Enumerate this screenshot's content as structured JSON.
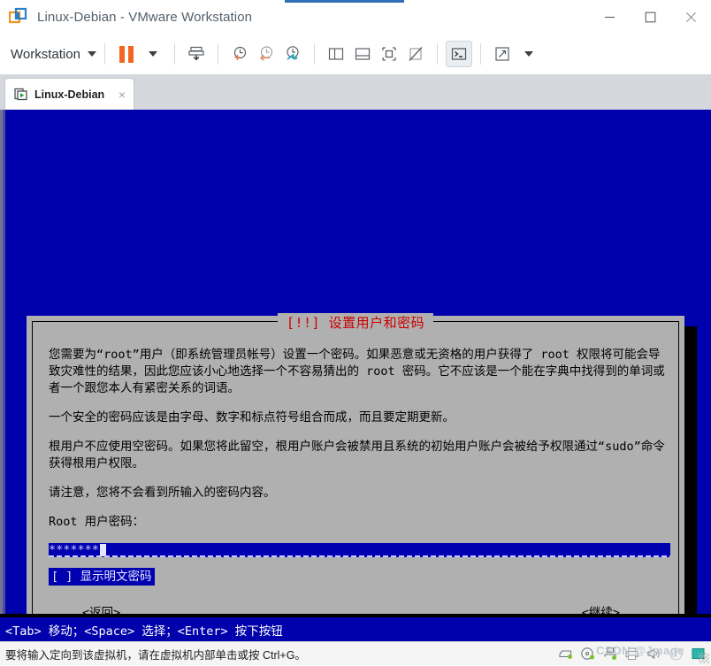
{
  "window": {
    "title": "Linux-Debian - VMware Workstation",
    "app_icon": "vmware-logo-icon",
    "controls": {
      "minimize": "minimize-icon",
      "maximize": "maximize-icon",
      "close": "close-icon"
    }
  },
  "toolbar": {
    "menu_label": "Workstation",
    "items": [
      {
        "name": "pause-button",
        "icon": "pause-icon"
      },
      {
        "name": "pause-dropdown",
        "icon": "chevron-down-icon"
      },
      {
        "name": "send-ctrl-alt-del-button",
        "icon": "keyboard-send-icon"
      },
      {
        "name": "take-snapshot-button",
        "icon": "snapshot-add-icon"
      },
      {
        "name": "revert-snapshot-button",
        "icon": "snapshot-revert-icon"
      },
      {
        "name": "manage-snapshots-button",
        "icon": "snapshot-manager-icon"
      },
      {
        "name": "show-library-button",
        "icon": "panel-left-icon"
      },
      {
        "name": "show-thumbnail-bar-button",
        "icon": "panel-bottom-icon"
      },
      {
        "name": "show-console-view-button",
        "icon": "console-view-icon"
      },
      {
        "name": "hide-console-view-button",
        "icon": "console-hidden-icon"
      },
      {
        "name": "unity-mode-button",
        "icon": "terminal-prompt-icon"
      },
      {
        "name": "fullscreen-button",
        "icon": "expand-arrows-icon"
      },
      {
        "name": "fullscreen-dropdown",
        "icon": "chevron-down-icon"
      }
    ]
  },
  "tab": {
    "label": "Linux-Debian",
    "icon": "vm-play-icon",
    "close": "×"
  },
  "vm": {
    "background_color": "#0000ac",
    "dialog": {
      "title": "[!!] 设置用户和密码",
      "title_color": "#cc0000",
      "paragraphs": [
        "您需要为“root”用户（即系统管理员帐号）设置一个密码。如果恶意或无资格的用户获得了 root 权限将可能会导致灾难性的结果，因此您应该小心地选择一个不容易猜出的 root 密码。它不应该是一个能在字典中找得到的单词或者一个跟您本人有紧密关系的词语。",
        "一个安全的密码应该是由字母、数字和标点符号组合而成，而且要定期更新。",
        "根用户不应使用空密码。如果您将此留空，根用户账户会被禁用且系统的初始用户账户会被给予权限通过“sudo”命令获得根用户权限。",
        "请注意，您将不会看到所输入的密码内容。"
      ],
      "field_label": "Root 用户密码：",
      "password_value": "*******",
      "checkbox": {
        "marker": "[ ]",
        "label": "显示明文密码",
        "checked": false
      },
      "buttons": {
        "back": "<返回>",
        "continue": "<继续>"
      }
    }
  },
  "helpbar": {
    "text": "<Tab> 移动；<Space> 选择；<Enter> 按下按钮"
  },
  "statusbar": {
    "message": "要将输入定向到该虚拟机，请在虚拟机内部单击或按 Ctrl+G。",
    "watermark": "CSDN @Jmage",
    "devices": [
      {
        "name": "hard-disk-icon"
      },
      {
        "name": "cd-dvd-icon"
      },
      {
        "name": "network-adapter-icon"
      },
      {
        "name": "printer-icon"
      },
      {
        "name": "sound-card-icon"
      },
      {
        "name": "usb-icon"
      },
      {
        "name": "display-icon"
      }
    ]
  },
  "colors": {
    "vm_blue": "#0000ac",
    "dialog_gray": "#b0b0b0",
    "highlight_blue": "#0000b0",
    "accent_orange": "#f26522",
    "title_red": "#cc0000"
  }
}
